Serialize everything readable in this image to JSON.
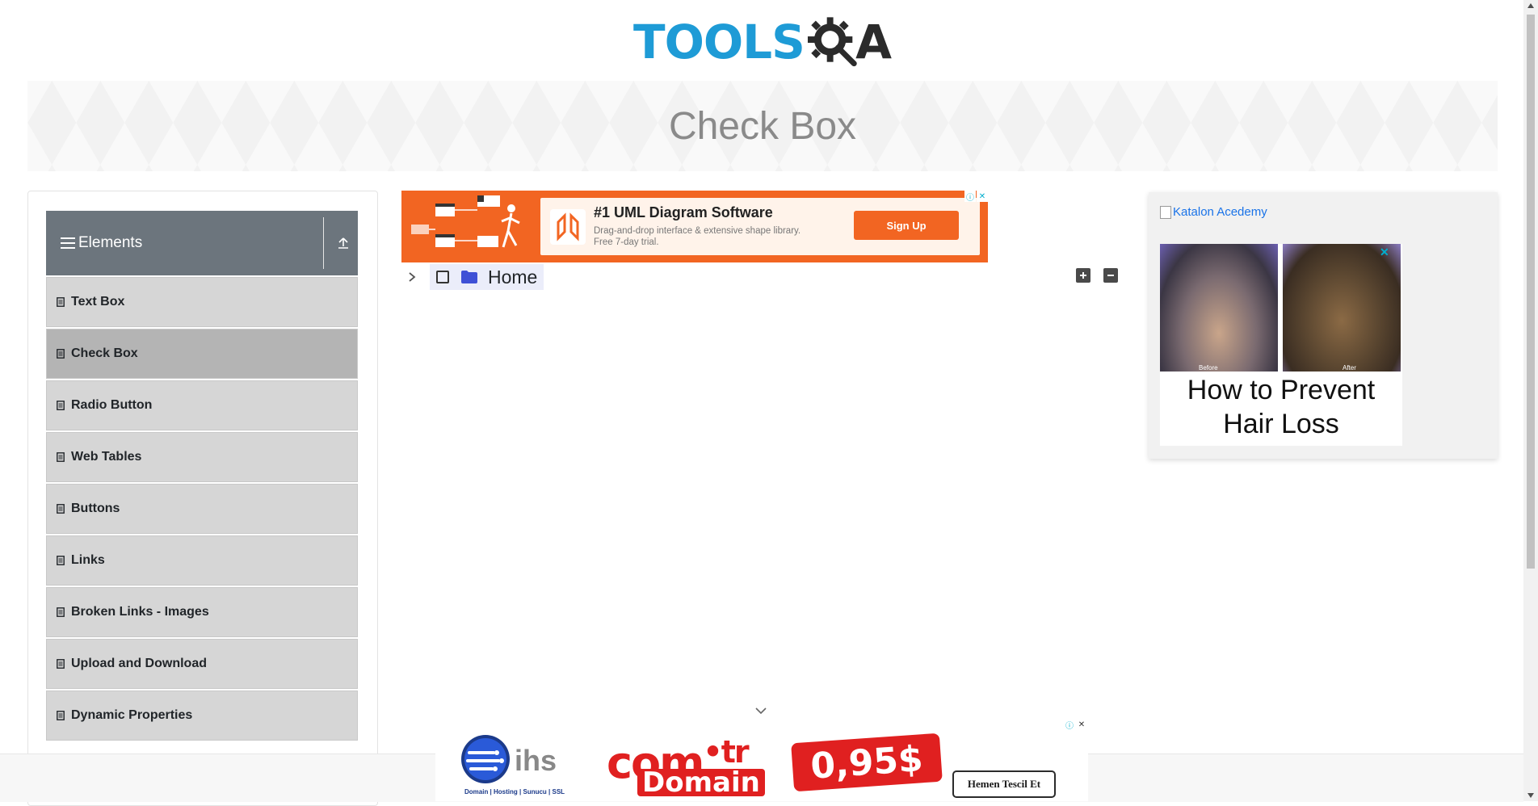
{
  "header": {
    "logo_text": "TOOLS",
    "logo_q": "Q",
    "logo_a": "A",
    "brand_color": "#1e9bd6"
  },
  "banner": {
    "title": "Check Box"
  },
  "sidebar": {
    "group_title": "Elements",
    "items": [
      {
        "label": "Text Box",
        "active": false
      },
      {
        "label": "Check Box",
        "active": true
      },
      {
        "label": "Radio Button",
        "active": false
      },
      {
        "label": "Web Tables",
        "active": false
      },
      {
        "label": "Buttons",
        "active": false
      },
      {
        "label": "Links",
        "active": false
      },
      {
        "label": "Broken Links - Images",
        "active": false
      },
      {
        "label": "Upload and Download",
        "active": false
      },
      {
        "label": "Dynamic Properties",
        "active": false
      }
    ]
  },
  "ad_top": {
    "title": "#1 UML Diagram Software",
    "desc_line1": "Drag-and-drop interface & extensive shape library.",
    "desc_line2": "Free 7-day trial.",
    "cta": "Sign Up",
    "accent": "#f26522"
  },
  "tree": {
    "root_label": "Home",
    "checked": false,
    "expanded": false
  },
  "ad_right": {
    "broken_img_alt": "Katalon Acedemy",
    "headline_line1": "How to Prevent",
    "headline_line2": "Hair Loss",
    "before_caption": "Before",
    "after_caption": "After"
  },
  "ad_bottom": {
    "brand": "ihs",
    "brand_sub": "Domain | Hosting | Sunucu | SSL",
    "tld_main": "com",
    "tld_dot": "•",
    "tld_tr": "tr",
    "domain_word": "Domain",
    "price": "0,95$",
    "cta": "Hemen Tescil Et",
    "accent": "#e02020"
  }
}
